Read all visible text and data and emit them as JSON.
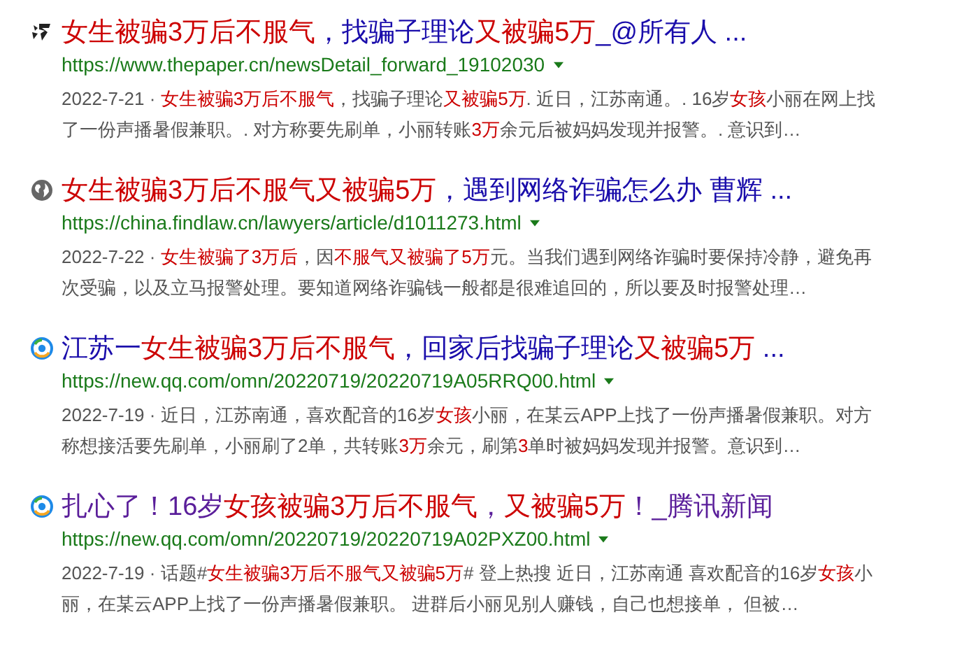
{
  "results": [
    {
      "visited": false,
      "title": "**女生被骗3万后不服气**，找骗子理论**又被骗5万**_@所有人 ...",
      "url": "https://www.thepaper.cn/newsDetail_forward_19102030",
      "snippet": "2022-7-21 · **女生被骗3万后不服气**，找骗子理论**又被骗5万**. 近日，江苏南通。. 16岁**女孩**小丽在网上找了一份声播暑假兼职。. 对方称要先刷单，小丽转账**3万**余元后被妈妈发现并报警。. 意识到…"
    },
    {
      "visited": false,
      "title": "**女生被骗3万后不服气又被骗5万**，遇到网络诈骗怎么办 曹辉 ...",
      "url": "https://china.findlaw.cn/lawyers/article/d1011273.html",
      "snippet": "2022-7-22 · **女生被骗了3万后**，因**不服气又被骗了5万**元。当我们遇到网络诈骗时要保持冷静，避免再次受骗，以及立马报警处理。要知道网络诈骗钱一般都是很难追回的，所以要及时报警处理…"
    },
    {
      "visited": false,
      "title": "江苏一**女生被骗3万后不服气**，回家后找骗子理论**又被骗5万** ...",
      "url": "https://new.qq.com/omn/20220719/20220719A05RRQ00.html",
      "snippet": "2022-7-19 · 近日，江苏南通，喜欢配音的16岁**女孩**小丽，在某云APP上找了一份声播暑假兼职。对方称想接活要先刷单，小丽刷了2单，共转账**3万**余元，刷第**3**单时被妈妈发现并报警。意识到…"
    },
    {
      "visited": true,
      "title": "扎心了！16岁**女孩被骗3万后不服气**，**又被骗5万**！_腾讯新闻",
      "url": "https://new.qq.com/omn/20220719/20220719A02PXZ00.html",
      "snippet": "2022-7-19 · 话题#**女生被骗3万后不服气又被骗5万**# 登上热搜 近日，江苏南通 喜欢配音的16岁**女孩**小丽，在某云APP上找了一份声播暑假兼职。 进群后小丽见别人赚钱，自己也想接单， 但被…"
    }
  ]
}
